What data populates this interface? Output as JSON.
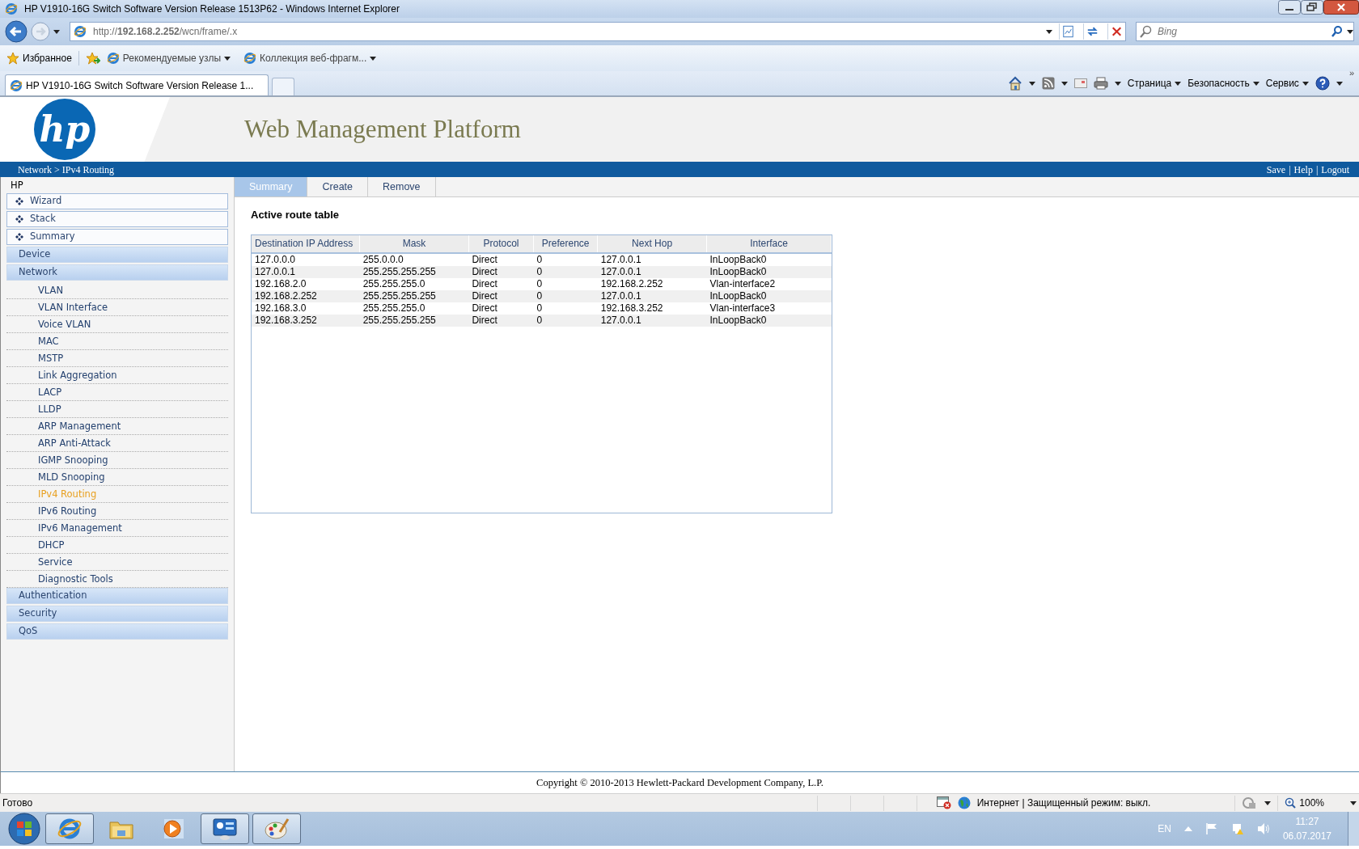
{
  "browser": {
    "title": "HP V1910-16G Switch Software Version Release 1513P62 - Windows Internet Explorer",
    "address": "http://**192.168.2.252**/wcn/frame/.x",
    "search": {
      "placeholder": "Bing"
    },
    "favorites": {
      "label": "Избранное",
      "links": [
        "Рекомендуемые узлы",
        "Коллекция веб-фрагм..."
      ]
    },
    "tabs": [
      {
        "label": "HP V1910-16G Switch Software Version Release 1...",
        "selected": true
      }
    ],
    "commands": [
      "Страница",
      "Безопасность",
      "Сервис"
    ],
    "overflow": "»"
  },
  "header": {
    "logo": "hp",
    "title": "Web Management Platform"
  },
  "nav_bar": {
    "breadcrumb": "Network > IPv4 Routing",
    "links": [
      "Save",
      "Help",
      "Logout"
    ],
    "separator": "|"
  },
  "sidebar": {
    "root": "HP",
    "items": [
      {
        "kind": "quick",
        "label": "Wizard"
      },
      {
        "kind": "quick",
        "label": "Stack"
      },
      {
        "kind": "quick",
        "label": "Summary"
      },
      {
        "kind": "group",
        "label": "Device"
      },
      {
        "kind": "group",
        "label": "Network",
        "children": [
          {
            "label": "VLAN",
            "selected": false
          },
          {
            "label": "VLAN Interface",
            "selected": false
          },
          {
            "label": "Voice VLAN",
            "selected": false
          },
          {
            "label": "MAC",
            "selected": false
          },
          {
            "label": "MSTP",
            "selected": false
          },
          {
            "label": "Link Aggregation",
            "selected": false
          },
          {
            "label": "LACP",
            "selected": false
          },
          {
            "label": "LLDP",
            "selected": false
          },
          {
            "label": "ARP Management",
            "selected": false
          },
          {
            "label": "ARP Anti-Attack",
            "selected": false
          },
          {
            "label": "IGMP Snooping",
            "selected": false
          },
          {
            "label": "MLD Snooping",
            "selected": false
          },
          {
            "label": "IPv4 Routing",
            "selected": true
          },
          {
            "label": "IPv6 Routing",
            "selected": false
          },
          {
            "label": "IPv6 Management",
            "selected": false
          },
          {
            "label": "DHCP",
            "selected": false
          },
          {
            "label": "Service",
            "selected": false
          },
          {
            "label": "Diagnostic Tools",
            "selected": false
          }
        ]
      },
      {
        "kind": "group",
        "label": "Authentication"
      },
      {
        "kind": "group",
        "label": "Security"
      },
      {
        "kind": "group",
        "label": "QoS"
      }
    ]
  },
  "tabs": [
    {
      "label": "Summary",
      "selected": true
    },
    {
      "label": "Create",
      "selected": false
    },
    {
      "label": "Remove",
      "selected": false
    }
  ],
  "content": {
    "heading": "Active route table",
    "table": {
      "columns": [
        "Destination IP Address",
        "Mask",
        "Protocol",
        "Preference",
        "Next Hop",
        "Interface"
      ],
      "rows": [
        [
          "127.0.0.0",
          "255.0.0.0",
          "Direct",
          "0",
          "127.0.0.1",
          "InLoopBack0"
        ],
        [
          "127.0.0.1",
          "255.255.255.255",
          "Direct",
          "0",
          "127.0.0.1",
          "InLoopBack0"
        ],
        [
          "192.168.2.0",
          "255.255.255.0",
          "Direct",
          "0",
          "192.168.2.252",
          "Vlan-interface2"
        ],
        [
          "192.168.2.252",
          "255.255.255.255",
          "Direct",
          "0",
          "127.0.0.1",
          "InLoopBack0"
        ],
        [
          "192.168.3.0",
          "255.255.255.0",
          "Direct",
          "0",
          "192.168.3.252",
          "Vlan-interface3"
        ],
        [
          "192.168.3.252",
          "255.255.255.255",
          "Direct",
          "0",
          "127.0.0.1",
          "InLoopBack0"
        ]
      ]
    }
  },
  "footer": "Copyright © 2010-2013 Hewlett-Packard Development Company, L.P.",
  "status_bar": {
    "text": "Готово",
    "zone": "Интернет | Защищенный режим: выкл.",
    "zoom": "100%"
  },
  "taskbar": {
    "apps": [
      {
        "kind": "ie",
        "running": true
      },
      {
        "kind": "folder",
        "running": false
      },
      {
        "kind": "media",
        "running": false
      },
      {
        "kind": "panel",
        "running": true
      },
      {
        "kind": "paint",
        "running": true
      }
    ],
    "language": "EN",
    "time": "11:27",
    "date": "06.07.2017"
  }
}
